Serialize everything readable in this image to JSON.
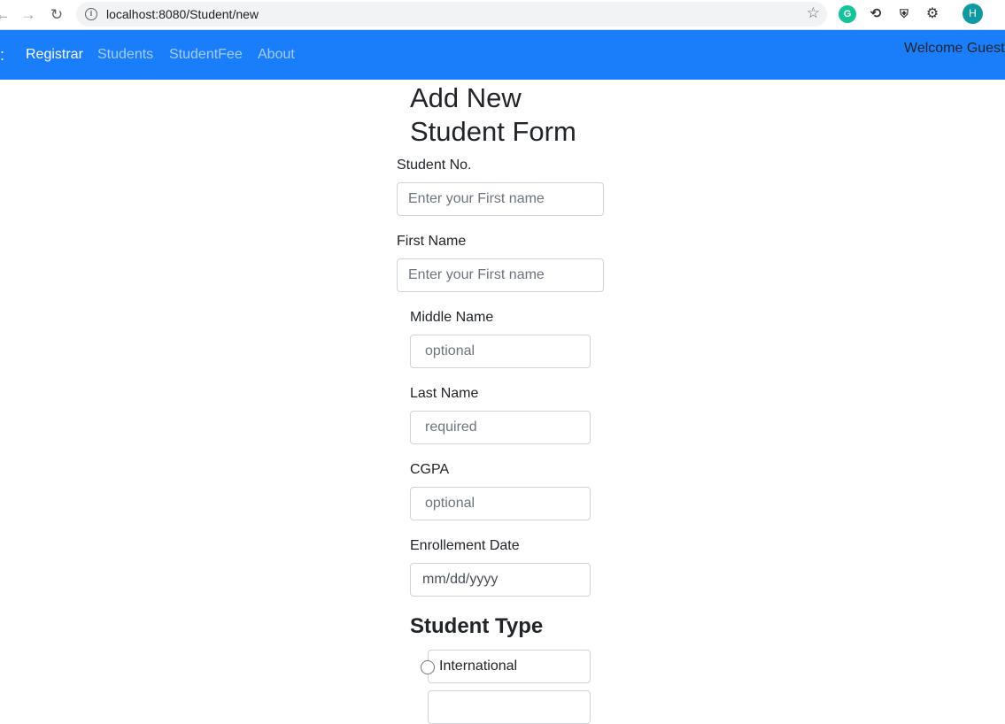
{
  "browser": {
    "url": "localhost:8080/Student/new",
    "back_icon": "arrow-left-icon",
    "forward_icon": "arrow-right-icon",
    "reload_icon": "reload-icon",
    "avatar_letter": "H",
    "grammarly_letter": "G"
  },
  "navbar": {
    "brand_tail": ":",
    "items": [
      {
        "label": "Registrar"
      },
      {
        "label": "Students"
      },
      {
        "label": "StudentFee"
      },
      {
        "label": "About"
      }
    ],
    "welcome": "Welcome Guest",
    "color": "#1a7efb"
  },
  "form": {
    "title_line1": "Add New",
    "title_line2": "Student Form",
    "student_no": {
      "label": "Student No.",
      "placeholder": "Enter your First name"
    },
    "first_name": {
      "label": "First Name",
      "placeholder": "Enter your First name"
    },
    "middle_name": {
      "label": "Middle Name",
      "placeholder": "optional"
    },
    "last_name": {
      "label": "Last Name",
      "placeholder": "required"
    },
    "cgpa": {
      "label": "CGPA",
      "placeholder": "optional"
    },
    "enrollment_date": {
      "label": "Enrollement Date",
      "placeholder": "mm/dd/yyyy"
    },
    "student_type": {
      "heading": "Student Type",
      "options": [
        {
          "label": "International"
        }
      ]
    }
  }
}
